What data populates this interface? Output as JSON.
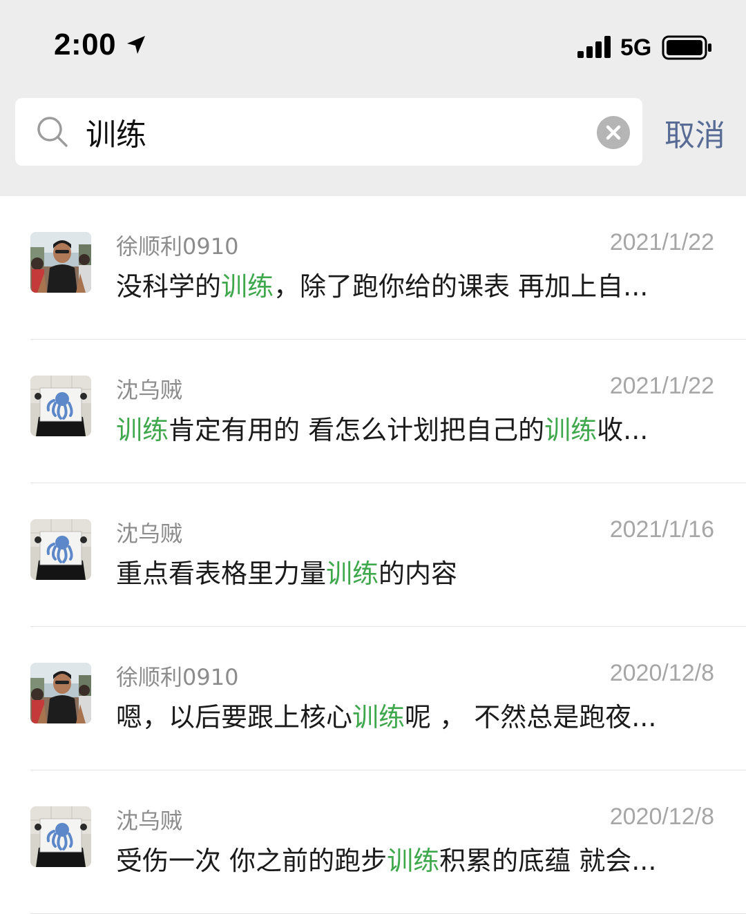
{
  "status_bar": {
    "time": "2:00",
    "network": "5G"
  },
  "search": {
    "query": "训练",
    "cancel_label": "取消"
  },
  "results": [
    {
      "sender": "徐顺利0910",
      "date": "2021/1/22",
      "message": [
        {
          "text": "没科学的",
          "highlight": false
        },
        {
          "text": "训练",
          "highlight": true
        },
        {
          "text": "，除了跑你给的课表  再加上自...",
          "highlight": false
        }
      ],
      "avatar": "runner"
    },
    {
      "sender": "沈乌贼",
      "date": "2021/1/22",
      "message": [
        {
          "text": "训练",
          "highlight": true
        },
        {
          "text": "肯定有用的 看怎么计划把自己的",
          "highlight": false
        },
        {
          "text": "训练",
          "highlight": true
        },
        {
          "text": "收...",
          "highlight": false
        }
      ],
      "avatar": "octopus-sign"
    },
    {
      "sender": "沈乌贼",
      "date": "2021/1/16",
      "message": [
        {
          "text": "重点看表格里力量",
          "highlight": false
        },
        {
          "text": "训练",
          "highlight": true
        },
        {
          "text": "的内容",
          "highlight": false
        }
      ],
      "avatar": "octopus-sign"
    },
    {
      "sender": "徐顺利0910",
      "date": "2020/12/8",
      "message": [
        {
          "text": "嗯，以后要跟上核心",
          "highlight": false
        },
        {
          "text": "训练",
          "highlight": true
        },
        {
          "text": "呢 ， 不然总是跑夜...",
          "highlight": false
        }
      ],
      "avatar": "runner"
    },
    {
      "sender": "沈乌贼",
      "date": "2020/12/8",
      "message": [
        {
          "text": "受伤一次 你之前的跑步",
          "highlight": false
        },
        {
          "text": "训练",
          "highlight": true
        },
        {
          "text": "积累的底蕴 就会...",
          "highlight": false
        }
      ],
      "avatar": "octopus-sign"
    }
  ],
  "colors": {
    "highlight": "#3fa84c",
    "cancel": "#576b95",
    "header_background": "#ededed"
  }
}
